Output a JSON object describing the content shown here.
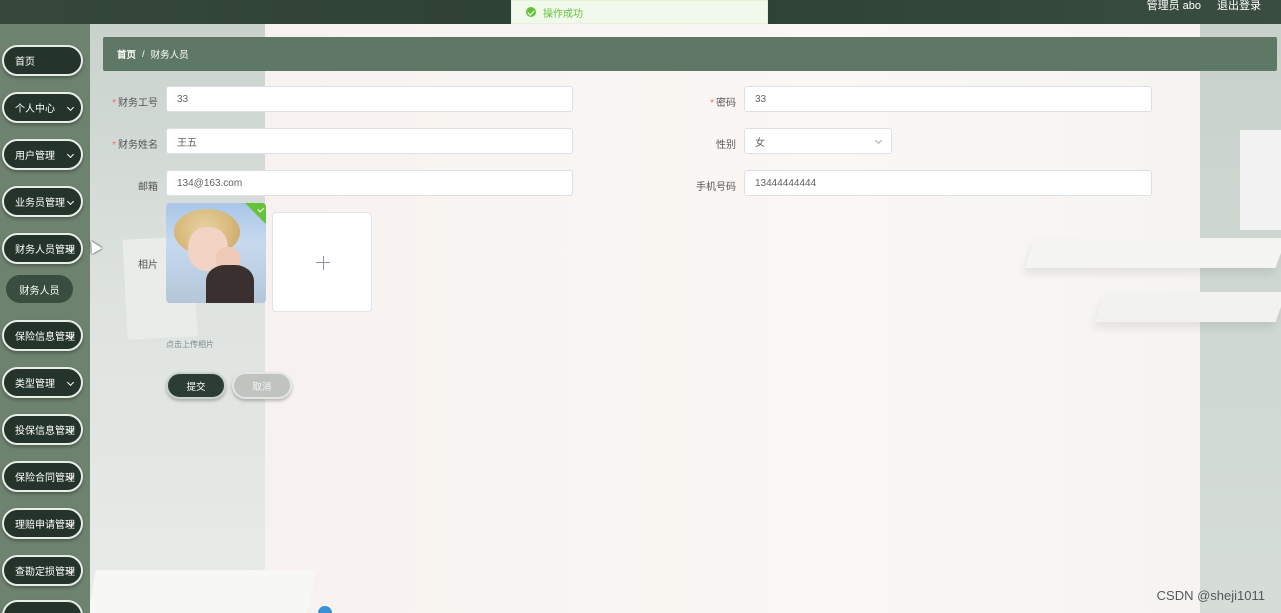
{
  "topbar": {
    "admin_label": "管理员 abo",
    "logout_label": "退出登录"
  },
  "toast": {
    "message": "操作成功"
  },
  "sidebar": {
    "items": [
      {
        "label": "首页",
        "has_chevron": false
      },
      {
        "label": "个人中心",
        "has_chevron": true
      },
      {
        "label": "用户管理",
        "has_chevron": true
      },
      {
        "label": "业务员管理",
        "has_chevron": true
      },
      {
        "label": "财务人员管理",
        "has_chevron": true
      },
      {
        "label": "保险信息管理",
        "has_chevron": true
      },
      {
        "label": "类型管理",
        "has_chevron": true
      },
      {
        "label": "投保信息管理",
        "has_chevron": true
      },
      {
        "label": "保险合同管理",
        "has_chevron": true
      },
      {
        "label": "理赔申请管理",
        "has_chevron": true
      },
      {
        "label": "查勘定损管理",
        "has_chevron": true
      }
    ],
    "subitem": "财务人员"
  },
  "breadcrumb": {
    "home": "首页",
    "separator": "/",
    "current": "财务人员"
  },
  "form": {
    "emp_no": {
      "label": "财务工号",
      "value": "33"
    },
    "password": {
      "label": "密码",
      "value": "33"
    },
    "name": {
      "label": "财务姓名",
      "value": "王五"
    },
    "gender": {
      "label": "性别",
      "value": "女"
    },
    "email": {
      "label": "邮箱",
      "value": "134@163.com"
    },
    "phone": {
      "label": "手机号码",
      "value": "13444444444"
    },
    "photo": {
      "label": "相片",
      "tip": "点击上传相片"
    }
  },
  "buttons": {
    "submit": "提交",
    "cancel": "取消"
  },
  "watermark": "CSDN @sheji1011",
  "colors": {
    "sidebar_button": "#24342a",
    "breadcrumb": "#5f7866",
    "success": "#67c23a",
    "required": "#f56c6c"
  }
}
